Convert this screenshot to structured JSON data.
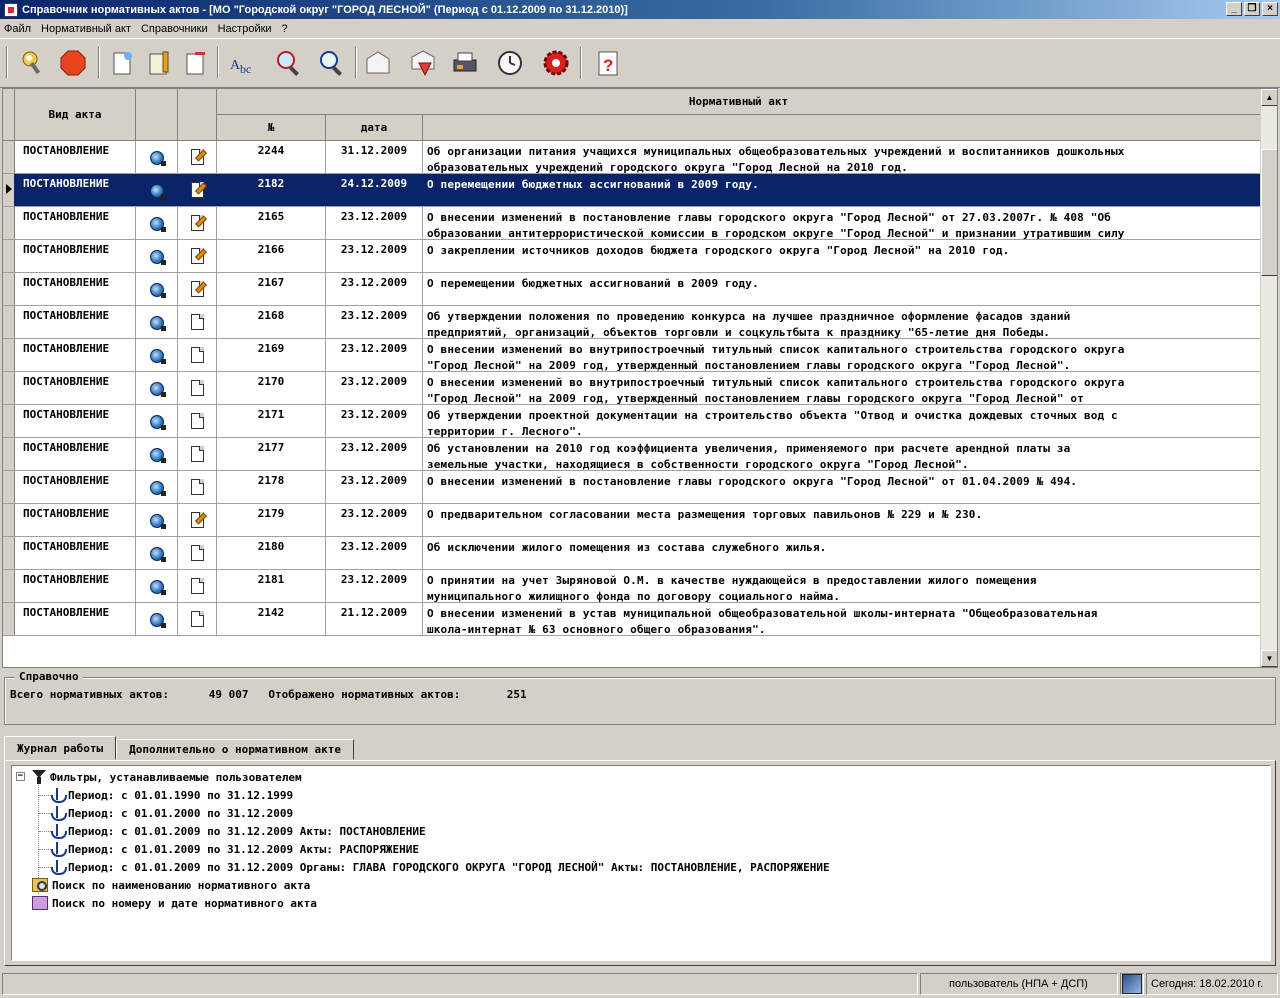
{
  "window": {
    "title": "Справочник нормативных актов - [МО \"Городской округ \"ГОРОД ЛЕСНОЙ\" (Период с 01.12.2009 по 31.12.2010)]"
  },
  "menu": {
    "items": [
      {
        "label": "Файл"
      },
      {
        "label": "Нормативный акт"
      },
      {
        "label": "Справочники"
      },
      {
        "label": "Настройки"
      },
      {
        "label": "?"
      }
    ]
  },
  "toolbar": {
    "icons": [
      "login-key-icon",
      "stop-icon",
      "new-document-icon",
      "edit-document-icon",
      "delete-document-icon",
      "spellcheck-icon",
      "search-icon",
      "find-icon",
      "envelope-icon",
      "envelope-filter-icon",
      "print-icon",
      "clock-icon",
      "settings-gear-icon",
      "help-icon"
    ]
  },
  "grid": {
    "headers": {
      "vid": "Вид акта",
      "group": "Нормативный акт",
      "num": "№",
      "date": "дата"
    },
    "rows": [
      {
        "vid": "ПОСТАНОВЛЕНИЕ",
        "num": "2244",
        "date": "31.12.2009",
        "text": "Об организации питания учащихся муниципальных общеобразовательных учреждений и воспитанников дошкольных\nобразовательных учреждений городского округа \"Город Лесной на 2010 год.",
        "edit": true
      },
      {
        "vid": "ПОСТАНОВЛЕНИЕ",
        "num": "2182",
        "date": "24.12.2009",
        "text": "О перемещении бюджетных ассигнований в 2009 году.",
        "edit": true,
        "selected": true
      },
      {
        "vid": "ПОСТАНОВЛЕНИЕ",
        "num": "2165",
        "date": "23.12.2009",
        "text": "О внесении изменений в постановление главы городского округа \"Город Лесной\" от 27.03.2007г. № 408 \"Об\nобразовании антитеррористической комиссии в городском округе \"Город Лесной\" и признании утратившим силу",
        "edit": true
      },
      {
        "vid": "ПОСТАНОВЛЕНИЕ",
        "num": "2166",
        "date": "23.12.2009",
        "text": "О закреплении источников доходов бюджета городского округа \"Город Лесной\" на 2010 год.",
        "edit": true
      },
      {
        "vid": "ПОСТАНОВЛЕНИЕ",
        "num": "2167",
        "date": "23.12.2009",
        "text": "О перемещении бюджетных ассигнований в 2009 году.",
        "edit": true
      },
      {
        "vid": "ПОСТАНОВЛЕНИЕ",
        "num": "2168",
        "date": "23.12.2009",
        "text": "Об утверждении положения по проведению конкурса на лучшее праздничное оформление фасадов зданий\nпредприятий, организаций, объектов торговли и соцкультбыта к празднику \"65-летие дня Победы.",
        "edit": false
      },
      {
        "vid": "ПОСТАНОВЛЕНИЕ",
        "num": "2169",
        "date": "23.12.2009",
        "text": "О внесении изменений во внутрипостроечный титульный список капитального строительства городского округа\n\"Город Лесной\" на 2009 год, утвержденный постановлением главы городского округа \"Город Лесной\".",
        "edit": false
      },
      {
        "vid": "ПОСТАНОВЛЕНИЕ",
        "num": "2170",
        "date": "23.12.2009",
        "text": "О внесении изменений во внутрипостроечный титульный список капитального строительства городского округа\n\"Город Лесной\" на 2009 год, утвержденный постановлением главы городского округа \"Город Лесной\" от",
        "edit": false
      },
      {
        "vid": "ПОСТАНОВЛЕНИЕ",
        "num": "2171",
        "date": "23.12.2009",
        "text": "Об утверждении проектной документации на строительство объекта \"Отвод и очистка дождевых сточных вод с\nтерритории г. Лесного\".",
        "edit": false
      },
      {
        "vid": "ПОСТАНОВЛЕНИЕ",
        "num": "2177",
        "date": "23.12.2009",
        "text": "Об установлении на 2010 год коэффициента увеличения, применяемого при расчете арендной платы за\nземельные участки, находящиеся в собственности городского округа \"Город Лесной\".",
        "edit": false
      },
      {
        "vid": "ПОСТАНОВЛЕНИЕ",
        "num": "2178",
        "date": "23.12.2009",
        "text": "О внесении изменений в постановление главы городского округа \"Город Лесной\" от 01.04.2009 № 494.",
        "edit": false
      },
      {
        "vid": "ПОСТАНОВЛЕНИЕ",
        "num": "2179",
        "date": "23.12.2009",
        "text": "О предварительном согласовании места размещения торговых павильонов № 229 и № 230.",
        "edit": true
      },
      {
        "vid": "ПОСТАНОВЛЕНИЕ",
        "num": "2180",
        "date": "23.12.2009",
        "text": "Об исключении жилого помещения из состава служебного жилья.",
        "edit": false
      },
      {
        "vid": "ПОСТАНОВЛЕНИЕ",
        "num": "2181",
        "date": "23.12.2009",
        "text": "О принятии на учет Зыряновой О.М. в качестве нуждающейся в предоставлении жилого помещения\nмуниципального жилищного фонда по договору социального найма.",
        "edit": false
      },
      {
        "vid": "ПОСТАНОВЛЕНИЕ",
        "num": "2142",
        "date": "21.12.2009",
        "text": "О внесении изменений в устав муниципальной общеобразовательной школы-интерната \"Общеобразовательная\nшкола-интернат № 63 основного общего образования\".",
        "edit": false
      }
    ]
  },
  "summary": {
    "legend": "Справочно",
    "total_label": "Всего нормативных актов:",
    "total_value": "49 007",
    "shown_label": "Отображено нормативных актов:",
    "shown_value": "251"
  },
  "tabs": [
    {
      "label": "Журнал работы",
      "active": true
    },
    {
      "label": "Дополнительно о нормативном акте",
      "active": false
    }
  ],
  "tree": {
    "root": "Фильтры, устанавливаемые пользователем",
    "filters": [
      "Период: с 01.01.1990 по 31.12.1999",
      "Период: с 01.01.2000 по 31.12.2009",
      "Период: с 01.01.2009 по 31.12.2009 Акты: ПОСТАНОВЛЕНИЕ",
      "Период: с 01.01.2009 по 31.12.2009 Акты: РАСПОРЯЖЕНИЕ",
      "Период: с 01.01.2009 по 31.12.2009 Органы: ГЛАВА ГОРОДСКОГО ОКРУГА \"ГОРОД ЛЕСНОЙ\" Акты: ПОСТАНОВЛЕНИЕ, РАСПОРЯЖЕНИЕ"
    ],
    "search_name": "Поиск по наименованию нормативного акта",
    "search_number": "Поиск по номеру и дате нормативного акта"
  },
  "status": {
    "user": "пользователь (НПА + ДСП)",
    "today": "Сегодня: 18.02.2010 г."
  },
  "colors": {
    "selection": "#0a246a",
    "face": "#d4d0c8"
  }
}
